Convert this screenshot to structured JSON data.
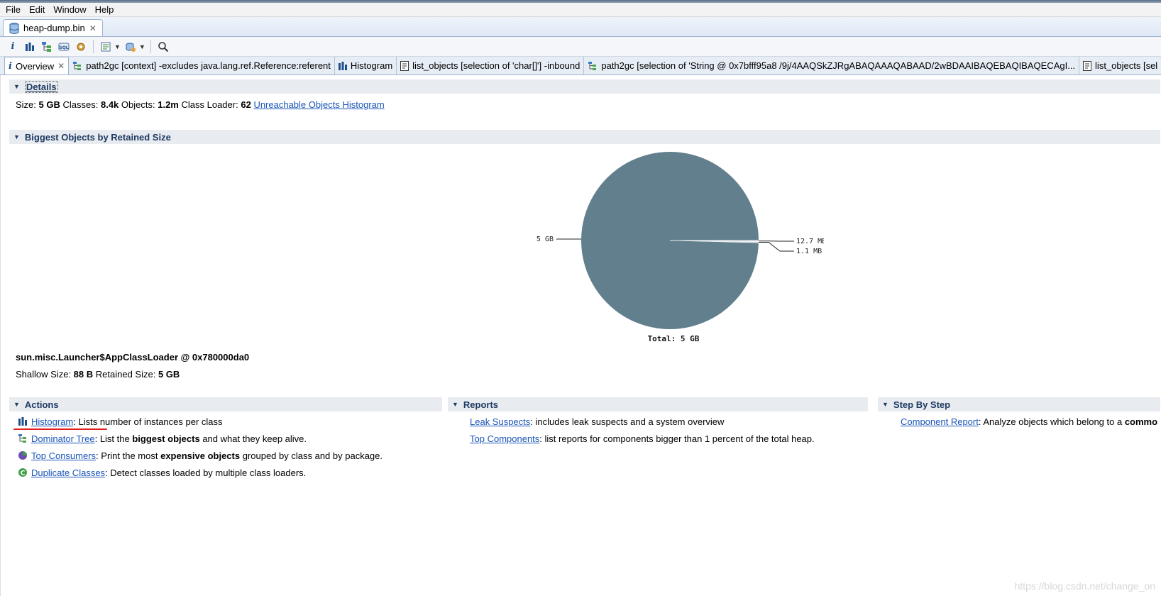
{
  "menu": [
    "File",
    "Edit",
    "Window",
    "Help"
  ],
  "editor_tab": {
    "label": "heap-dump.bin"
  },
  "subtabs": [
    {
      "label": "Overview",
      "icon": "info-icon",
      "closable": true,
      "active": true
    },
    {
      "label": "path2gc [context] -excludes java.lang.ref.Reference:referent",
      "icon": "path-tree-icon"
    },
    {
      "label": "Histogram",
      "icon": "histogram-icon"
    },
    {
      "label": "list_objects [selection of 'char[]'] -inbound",
      "icon": "list-objects-icon"
    },
    {
      "label": "path2gc [selection of 'String @ 0x7bfff95a8  /9j/4AAQSkZJRgABAQAAAQABAAD/2wBDAAIBAQEBAQIBAQECAgI...",
      "icon": "path-tree-icon"
    },
    {
      "label": "list_objects [sel",
      "icon": "list-objects-icon"
    }
  ],
  "details": {
    "title": "Details",
    "size_label": "Size:",
    "size_value": "5 GB",
    "classes_label": "Classes:",
    "classes_value": "8.4k",
    "objects_label": "Objects:",
    "objects_value": "1.2m",
    "loader_label": "Class Loader:",
    "loader_value": "62",
    "link": "Unreachable Objects Histogram"
  },
  "biggest": {
    "title": "Biggest Objects by Retained Size",
    "object_name": "sun.misc.Launcher$AppClassLoader @ 0x780000da0",
    "shallow_label": "Shallow Size:",
    "shallow_value": "88 B",
    "retained_label": "Retained Size:",
    "retained_value": "5 GB"
  },
  "chart_data": {
    "type": "pie",
    "slices": [
      {
        "label": "5 GB",
        "value": 5120,
        "color": "#627f8e"
      },
      {
        "label": "12.7 MB",
        "value": 12.7,
        "color": "#d9dfe3"
      },
      {
        "label": "1.1 MB",
        "value": 1.1,
        "color": "#c7cfd5"
      }
    ],
    "total_label": "Total: 5 GB"
  },
  "actions": {
    "title": "Actions",
    "items": [
      {
        "link": "Histogram",
        "desc_1": ": Lists number of instances per class",
        "bold": "",
        "desc_2": ""
      },
      {
        "link": "Dominator Tree",
        "desc_1": ": List the ",
        "bold": "biggest objects",
        "desc_2": " and what they keep alive."
      },
      {
        "link": "Top Consumers",
        "desc_1": ": Print the most ",
        "bold": "expensive objects",
        "desc_2": " grouped by class and by package."
      },
      {
        "link": "Duplicate Classes",
        "desc_1": ": Detect classes loaded by multiple class loaders.",
        "bold": "",
        "desc_2": ""
      }
    ]
  },
  "reports": {
    "title": "Reports",
    "items": [
      {
        "link": "Leak Suspects",
        "desc": ": includes leak suspects and a system overview"
      },
      {
        "link": "Top Components",
        "desc": ": list reports for components bigger than 1 percent of the total heap."
      }
    ]
  },
  "step_by_step": {
    "title": "Step By Step",
    "link": "Component Report",
    "desc": ": Analyze objects which belong to a ",
    "bold": "commo"
  },
  "watermark": "https://blog.csdn.net/change_on",
  "colors": {
    "pie": "#627f8e",
    "link": "#1a55b8",
    "section_bg": "#e8ebef",
    "underline_annotation": "#e0201e"
  }
}
